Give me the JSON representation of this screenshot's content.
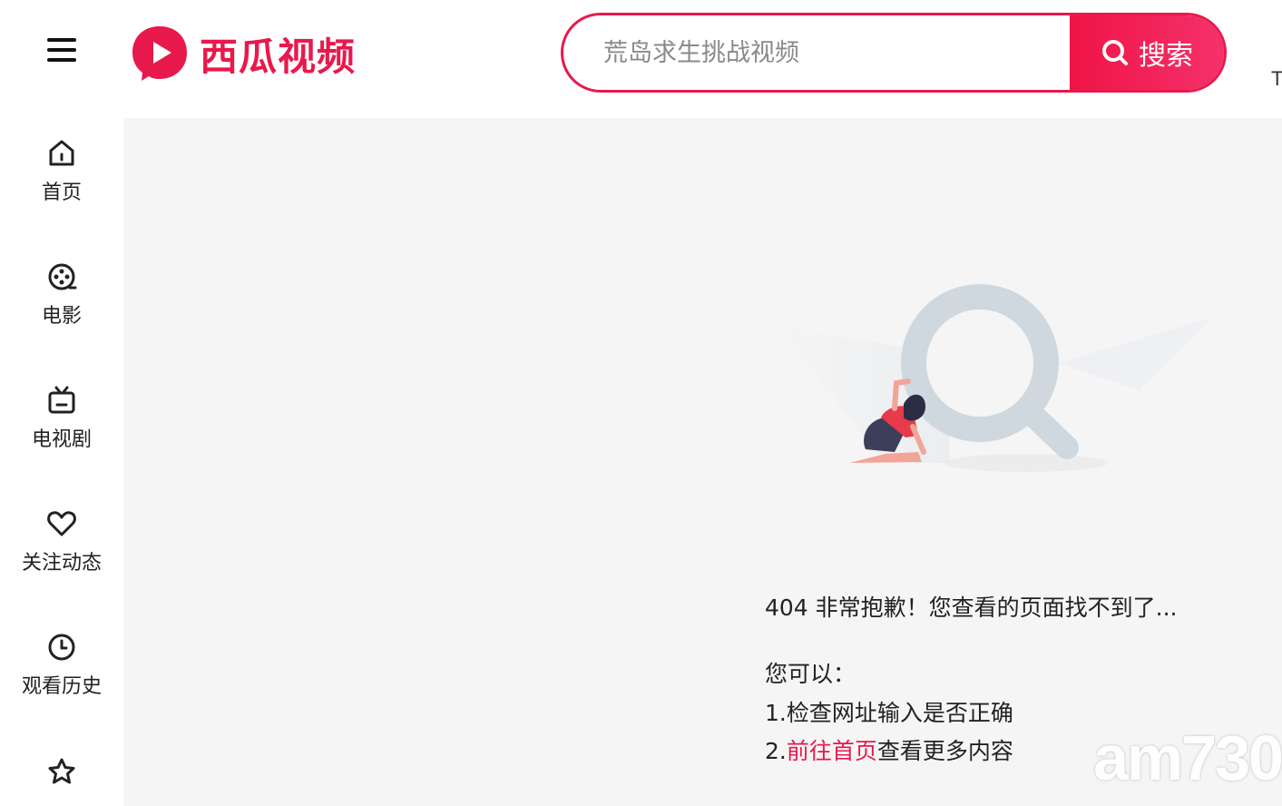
{
  "brand": {
    "name": "西瓜视频",
    "color": "#e8194c"
  },
  "search": {
    "placeholder": "荒岛求生挑战视频",
    "button_label": "搜索"
  },
  "header": {
    "edge_char": "T"
  },
  "sidebar": {
    "items": [
      {
        "label": "首页",
        "icon": "home-icon"
      },
      {
        "label": "电影",
        "icon": "film-reel-icon"
      },
      {
        "label": "电视剧",
        "icon": "tv-icon"
      },
      {
        "label": "关注动态",
        "icon": "heart-icon"
      },
      {
        "label": "观看历史",
        "icon": "clock-icon"
      },
      {
        "label": "",
        "icon": "star-icon"
      }
    ]
  },
  "error": {
    "title": "404 非常抱歉！您查看的页面找不到了...",
    "you_can": "您可以：",
    "step1": "1.检查网址输入是否正确",
    "step2_prefix": "2.",
    "step2_link": "前往首页",
    "step2_suffix": "查看更多内容"
  },
  "watermark": "am730"
}
